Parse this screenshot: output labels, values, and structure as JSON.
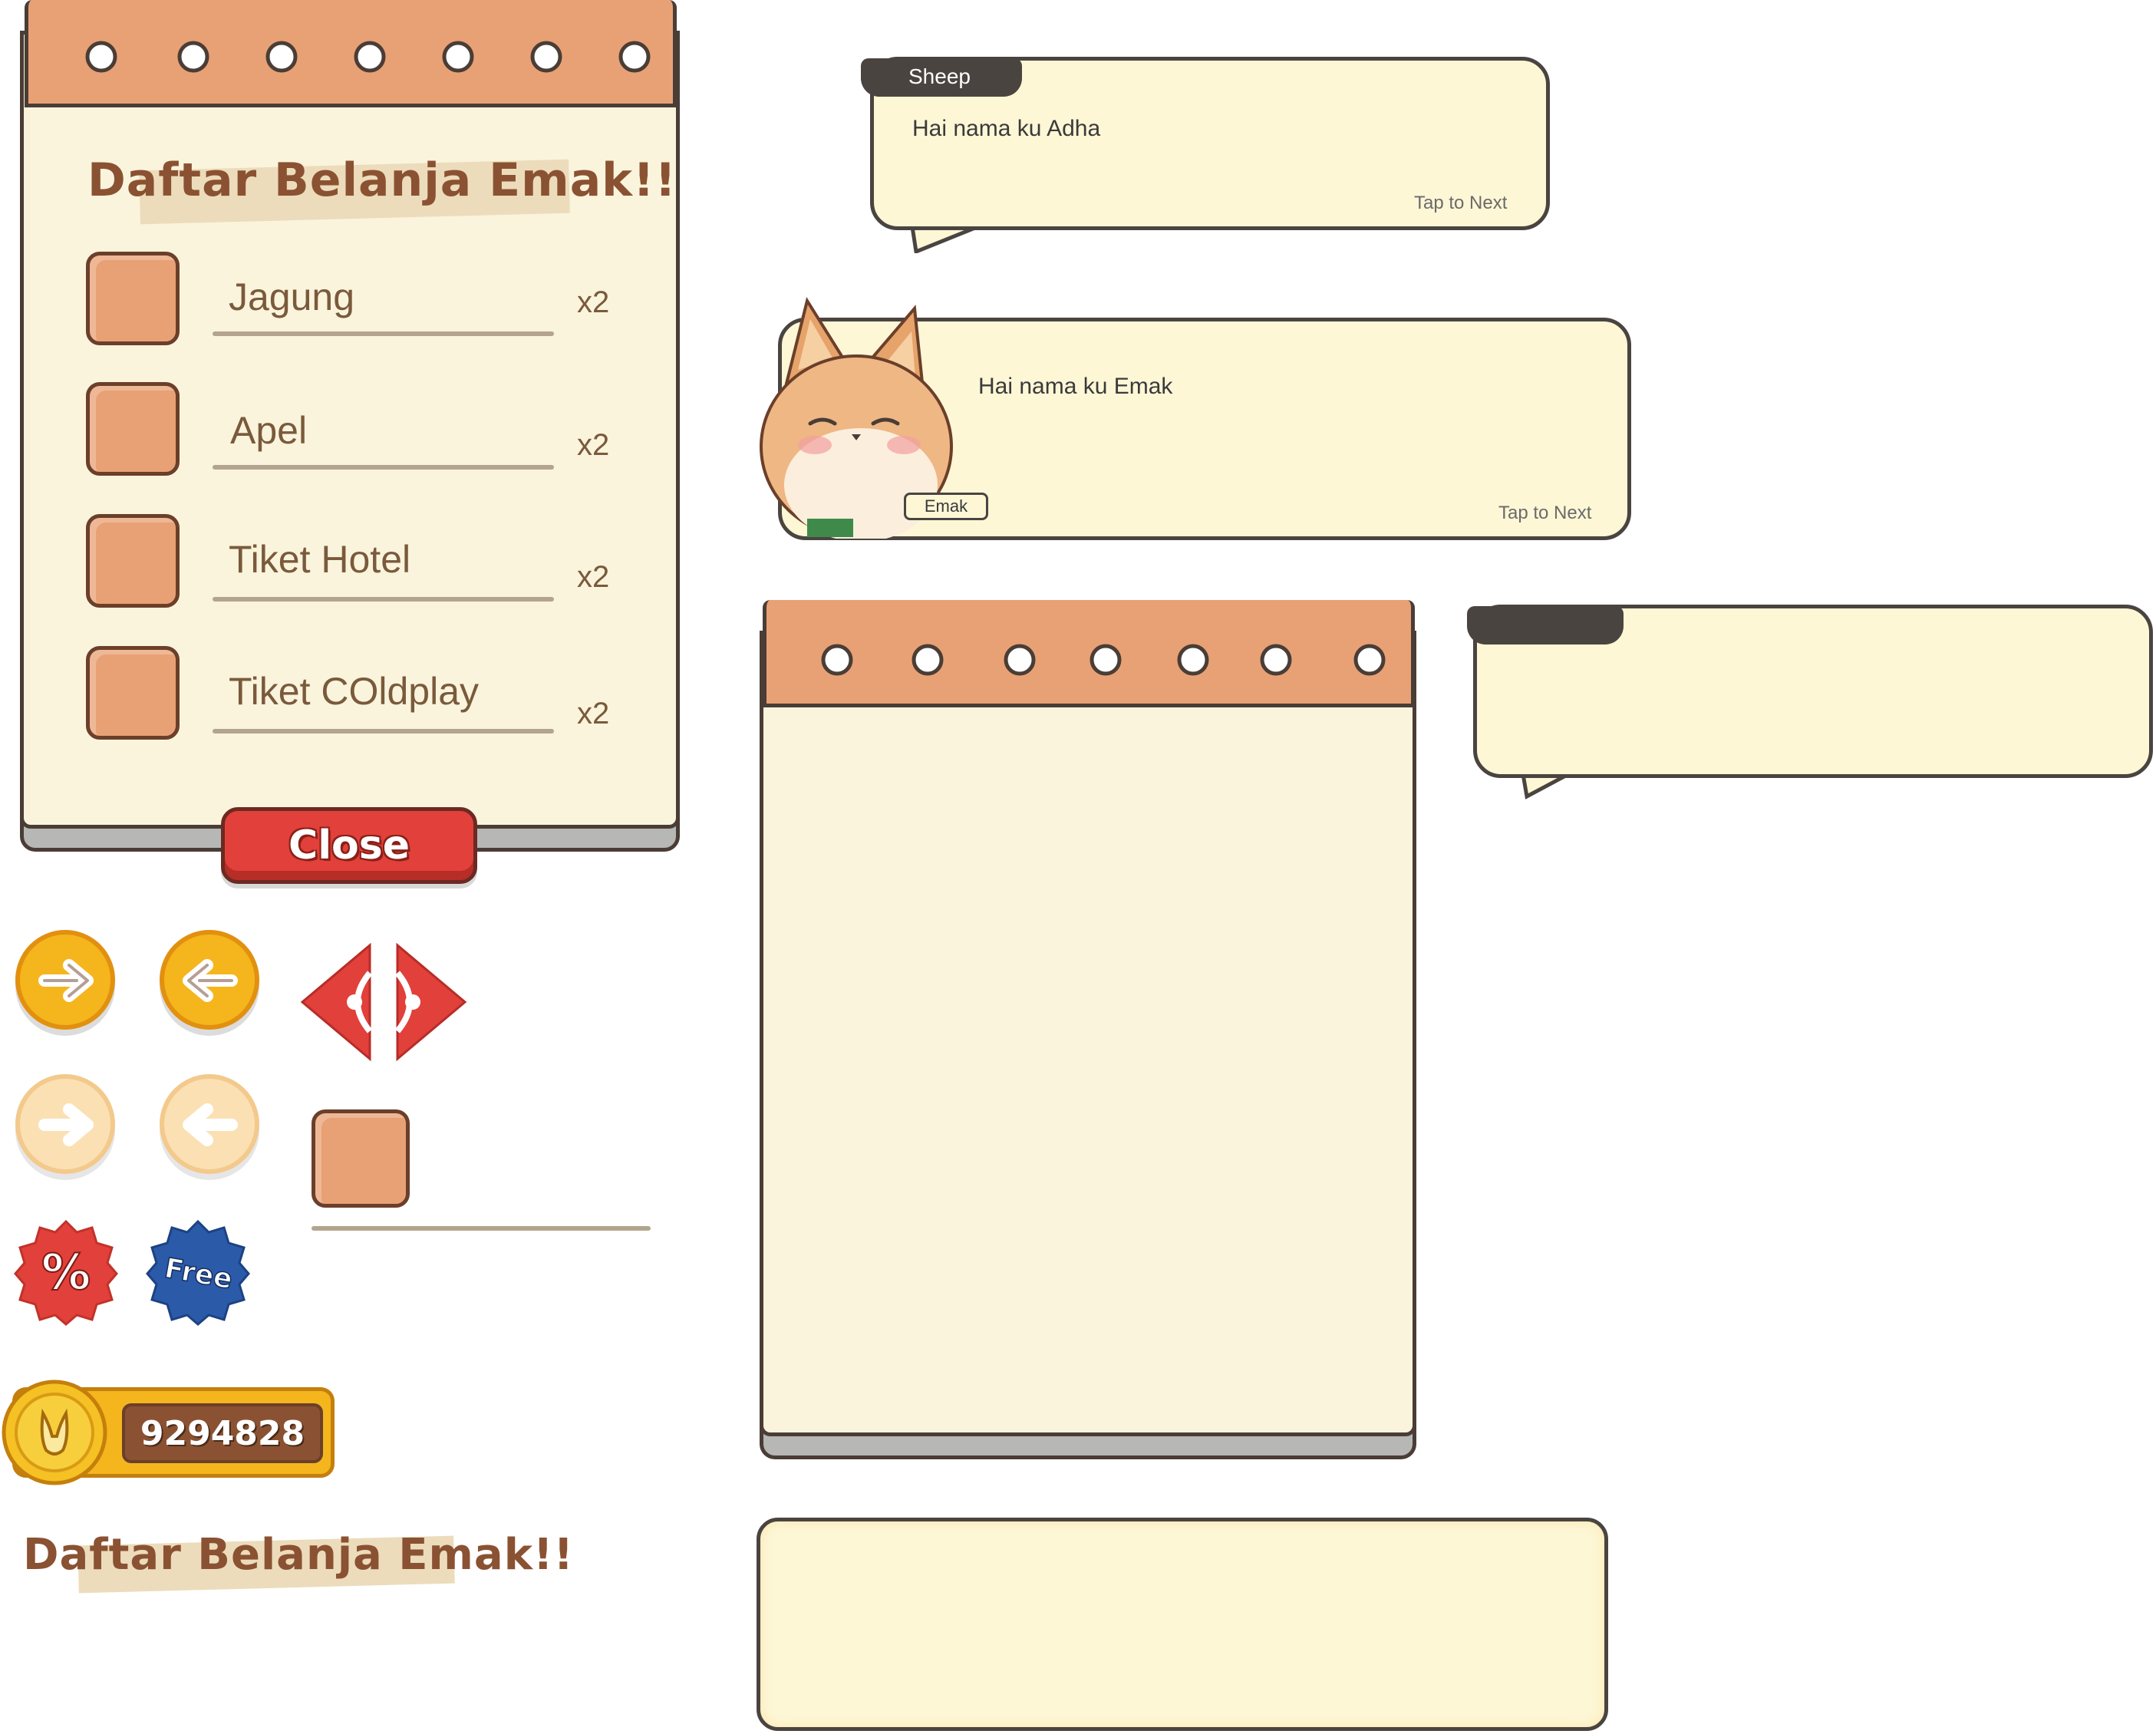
{
  "shopping_list": {
    "title": "Daftar Belanja Emak!!",
    "items": [
      {
        "label": "Jagung",
        "qty": "x2"
      },
      {
        "label": "Apel",
        "qty": "x2"
      },
      {
        "label": "Tiket Hotel",
        "qty": "x2"
      },
      {
        "label": "Tiket COldplay",
        "qty": "x2"
      }
    ],
    "close_label": "Close"
  },
  "dialog1": {
    "speaker": "Sheep",
    "text": "Hai nama ku Adha",
    "hint": "Tap to Next"
  },
  "dialog2": {
    "speaker": "Emak",
    "text": "Hai nama ku Emak",
    "hint": "Tap to Next"
  },
  "badges": {
    "discount": "%",
    "free": "Free"
  },
  "coins": {
    "amount": "9294828"
  },
  "title_logo": "Daftar Belanja Emak!!",
  "colors": {
    "paper": "#faf4dd",
    "binding": "#e8a175",
    "outline": "#4a3d36",
    "close_red": "#e2403a",
    "yellow_button": "#f5b51d",
    "bubble": "#fdf7d6"
  }
}
